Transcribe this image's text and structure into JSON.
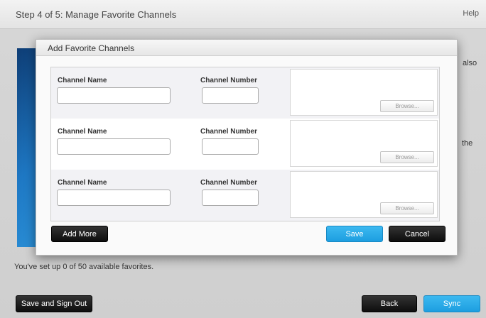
{
  "header": {
    "step_title": "Step 4 of 5: Manage Favorite Channels",
    "help": "Help"
  },
  "background": {
    "fragment_also": "also",
    "fragment_the": "the",
    "status_text": "You've set up 0 of 50 available favorites."
  },
  "footer": {
    "save_signout": "Save and Sign Out",
    "back": "Back",
    "sync": "Sync"
  },
  "modal": {
    "title": "Add Favorite Channels",
    "rows": [
      {
        "channel_name_label": "Channel Name",
        "channel_number_label": "Channel Number",
        "channel_name_value": "",
        "channel_number_value": "",
        "browse": "Browse..."
      },
      {
        "channel_name_label": "Channel Name",
        "channel_number_label": "Channel Number",
        "channel_name_value": "",
        "channel_number_value": "",
        "browse": "Browse..."
      },
      {
        "channel_name_label": "Channel Name",
        "channel_number_label": "Channel Number",
        "channel_name_value": "",
        "channel_number_value": "",
        "browse": "Browse..."
      }
    ],
    "add_more": "Add More",
    "save": "Save",
    "cancel": "Cancel"
  },
  "colors": {
    "accent_blue": "#1d9ee0",
    "dark_button": "#111111",
    "brand_panel": "#1e78c4"
  }
}
